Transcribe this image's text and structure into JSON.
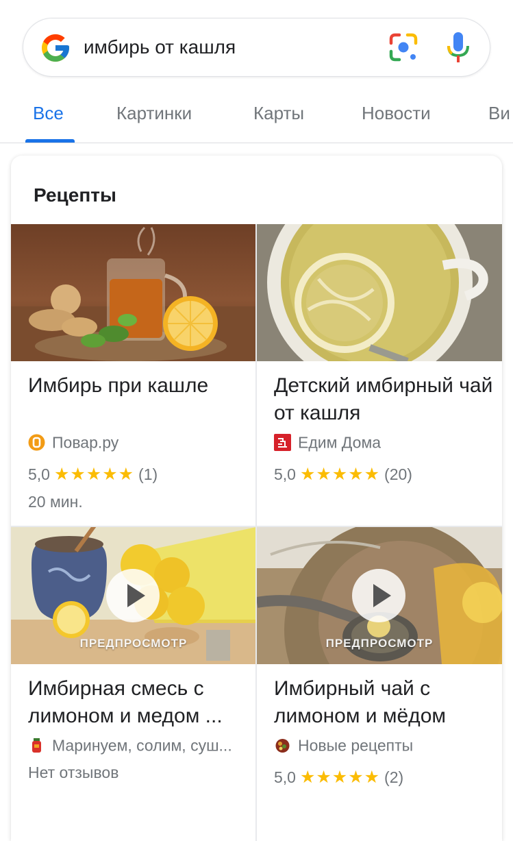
{
  "search": {
    "query": "имбирь от кашля"
  },
  "tabs": [
    {
      "label": "Все",
      "active": true
    },
    {
      "label": "Картинки"
    },
    {
      "label": "Карты"
    },
    {
      "label": "Новости"
    },
    {
      "label": "Ви"
    }
  ],
  "recipes_card": {
    "title": "Рецепты",
    "items": [
      {
        "title": "Имбирь при кашле",
        "source": "Повар.ру",
        "source_icon": "povar-ru-icon",
        "rating": "5,0",
        "stars": "★★★★★",
        "reviews": "(1)",
        "time": "20 мин."
      },
      {
        "title": "Детский имбирный чай от кашля",
        "source": "Едим Дома",
        "source_icon": "edim-doma-icon",
        "rating": "5,0",
        "stars": "★★★★★",
        "reviews": "(20)"
      },
      {
        "title": "Имбирная смесь с лимоном и медом ...",
        "source": "Маринуем, солим, суш...",
        "source_icon": "jar-icon",
        "no_reviews": "Нет отзывов",
        "preview_label": "ПРЕДПРОСМОТР"
      },
      {
        "title": "Имбирный чай с лимоном и мёдом",
        "source": "Новые рецепты",
        "source_icon": "novye-recepty-icon",
        "rating": "5,0",
        "stars": "★★★★★",
        "reviews": "(2)",
        "preview_label": "ПРЕДПРОСМОТР"
      }
    ]
  },
  "colors": {
    "accent": "#1a73e8",
    "star": "#fbbc04",
    "text_secondary": "#70757a"
  }
}
